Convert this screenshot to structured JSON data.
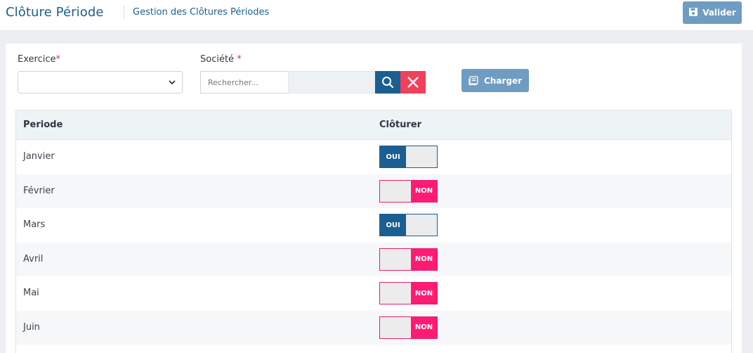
{
  "header": {
    "title": "Clôture Période",
    "breadcrumb": "Gestion des Clôtures Périodes",
    "validate_label": "Valider",
    "validate_icon": "save-icon"
  },
  "form": {
    "exercice_label": "Exercice",
    "exercice_value": "",
    "societe_label": "Société",
    "required_mark": "*",
    "search_placeholder": "Rechercher...",
    "search_icon": "search-icon",
    "clear_icon": "close-icon",
    "load_label": "Charger",
    "load_icon": "stack-icon"
  },
  "table": {
    "headers": [
      "Periode",
      "Clôturer"
    ],
    "rows": [
      {
        "period": "Janvier",
        "state": "OUI"
      },
      {
        "period": "Février",
        "state": "NON"
      },
      {
        "period": "Mars",
        "state": "OUI"
      },
      {
        "period": "Avril",
        "state": "NON"
      },
      {
        "period": "Mai",
        "state": "NON"
      },
      {
        "period": "Juin",
        "state": "NON"
      }
    ]
  },
  "colors": {
    "primary": "#1b5e91",
    "button_muted": "#6f9cc2",
    "toggle_off": "#ff1a73",
    "clear": "#f2405a"
  }
}
